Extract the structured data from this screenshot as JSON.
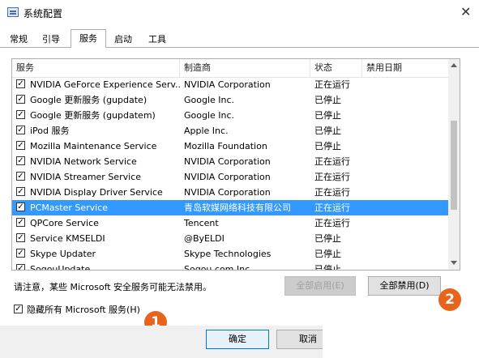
{
  "window": {
    "title": "系统配置",
    "close": "✕"
  },
  "tabs": [
    {
      "label": "常规"
    },
    {
      "label": "引导"
    },
    {
      "label": "服务"
    },
    {
      "label": "启动"
    },
    {
      "label": "工具"
    }
  ],
  "table": {
    "columns": [
      "服务",
      "制造商",
      "状态",
      "禁用日期"
    ],
    "rows": [
      {
        "checked": true,
        "service": "NVIDIA GeForce Experience Serv...",
        "vendor": "NVIDIA Corporation",
        "status": "正在运行",
        "date": ""
      },
      {
        "checked": true,
        "service": "Google 更新服务 (gupdate)",
        "vendor": "Google Inc.",
        "status": "已停止",
        "date": ""
      },
      {
        "checked": true,
        "service": "Google 更新服务 (gupdatem)",
        "vendor": "Google Inc.",
        "status": "已停止",
        "date": ""
      },
      {
        "checked": true,
        "service": "iPod 服务",
        "vendor": "Apple Inc.",
        "status": "已停止",
        "date": ""
      },
      {
        "checked": true,
        "service": "Mozilla Maintenance Service",
        "vendor": "Mozilla Foundation",
        "status": "已停止",
        "date": ""
      },
      {
        "checked": true,
        "service": "NVIDIA Network Service",
        "vendor": "NVIDIA Corporation",
        "status": "正在运行",
        "date": ""
      },
      {
        "checked": true,
        "service": "NVIDIA Streamer Service",
        "vendor": "NVIDIA Corporation",
        "status": "正在运行",
        "date": ""
      },
      {
        "checked": true,
        "service": "NVIDIA Display Driver Service",
        "vendor": "NVIDIA Corporation",
        "status": "正在运行",
        "date": ""
      },
      {
        "checked": true,
        "service": "PCMaster Service",
        "vendor": "青岛软媒网络科技有限公司",
        "status": "正在运行",
        "date": "",
        "selected": true
      },
      {
        "checked": true,
        "service": "QPCore Service",
        "vendor": "Tencent",
        "status": "正在运行",
        "date": ""
      },
      {
        "checked": true,
        "service": "Service KMSELDI",
        "vendor": "@ByELDI",
        "status": "已停止",
        "date": ""
      },
      {
        "checked": true,
        "service": "Skype Updater",
        "vendor": "Skype Technologies",
        "status": "已停止",
        "date": ""
      },
      {
        "checked": true,
        "service": "SogouUpdate",
        "vendor": "Sogou.com Inc.",
        "status": "已停止",
        "date": ""
      }
    ]
  },
  "note": "请注意，某些 Microsoft 安全服务可能无法禁用。",
  "buttons": {
    "enable_all": "全部启用(E)",
    "disable_all": "全部禁用(D)",
    "ok": "确定",
    "cancel": "取消"
  },
  "hide_ms": {
    "checked": true,
    "label": "隐藏所有 Microsoft 服务(H)"
  },
  "annotations": {
    "one": "1",
    "two": "2"
  },
  "colors": {
    "selection": "#3399ff",
    "badge": "#e8641d",
    "focus": "#0078d7"
  }
}
